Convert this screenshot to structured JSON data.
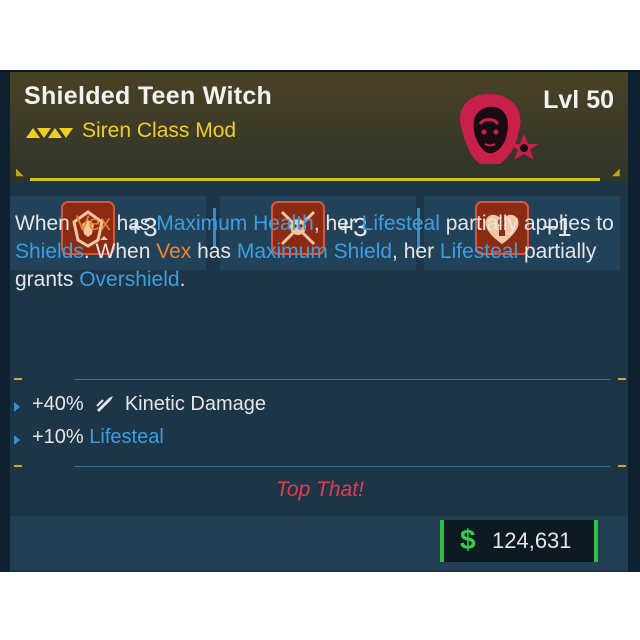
{
  "item": {
    "name": "Shielded Teen Witch",
    "type": "Siren Class Mod",
    "level": "Lvl 50"
  },
  "rarity_color": "#f0cf25",
  "stats": [
    {
      "icon": "shield-emblem-icon",
      "value": "+3"
    },
    {
      "icon": "crossed-swords-skull-icon",
      "value": "+3"
    },
    {
      "icon": "heart-figure-icon",
      "value": "+1"
    }
  ],
  "description": {
    "s1": "When ",
    "vex1": "Vex",
    "s2": " has ",
    "max_health": "Maximum Health",
    "s3": ", her ",
    "lifesteal1": "Lifesteal",
    "s4": " partially applies to ",
    "shields": "Shields",
    "s5": ". When ",
    "vex2": "Vex",
    "s6": " has ",
    "max_shield": "Maximum Shield",
    "s7": ", her ",
    "lifesteal2": "Lifesteal",
    "s8": " partially grants ",
    "overshield": "Overshield",
    "s9": "."
  },
  "bonuses": [
    {
      "prefix": "+40%",
      "icon": "kinetic-bullet-icon",
      "label": "Kinetic Damage"
    },
    {
      "prefix": "+10%",
      "label": "Lifesteal"
    }
  ],
  "flavor_text": "Top That!",
  "price": {
    "currency_icon": "dollar-icon",
    "amount": "124,631"
  }
}
